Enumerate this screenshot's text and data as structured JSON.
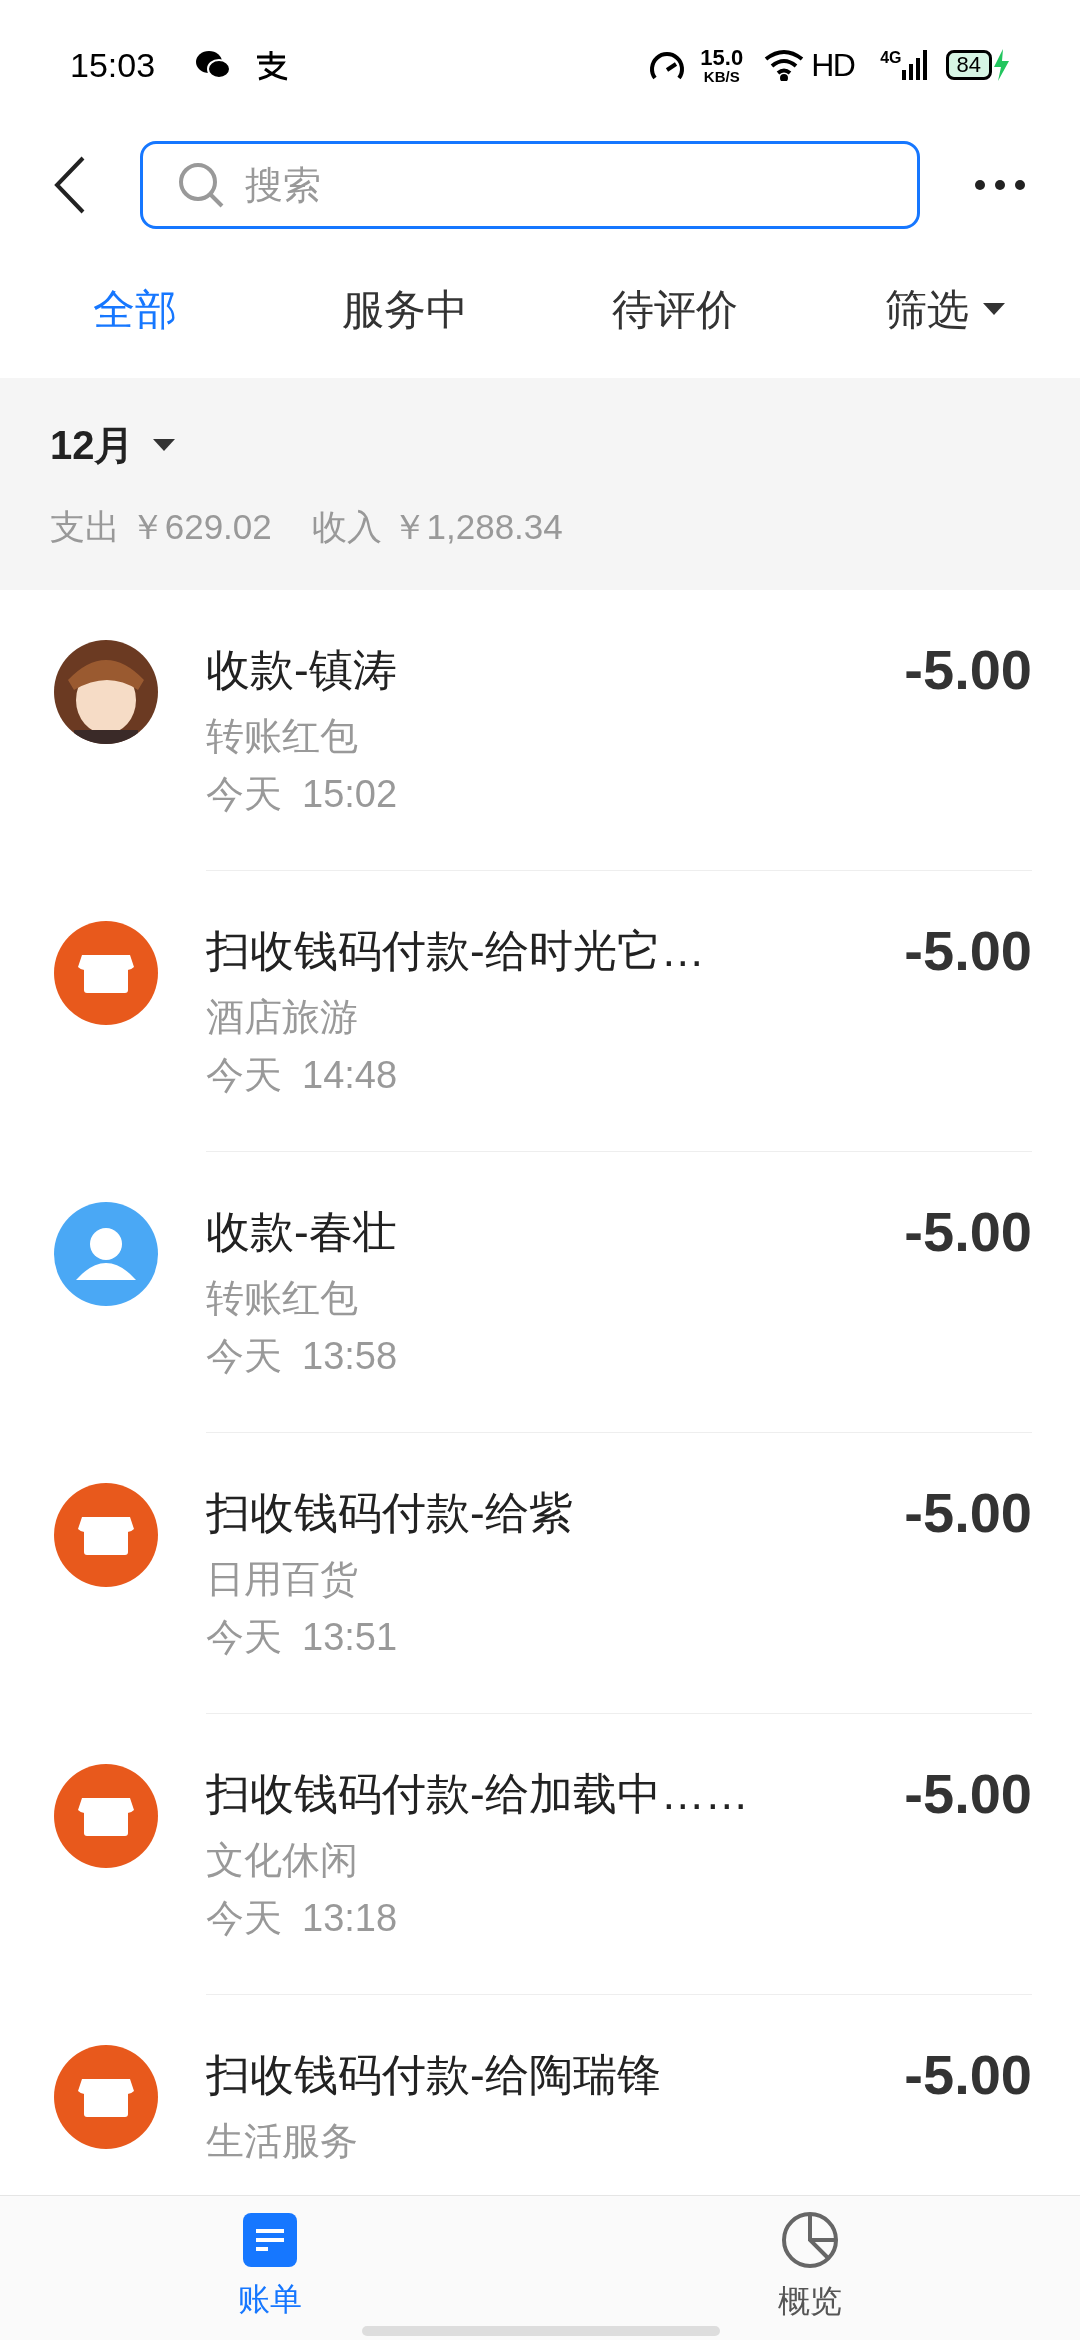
{
  "status_bar": {
    "time": "15:03",
    "speed": "15.0",
    "speed_unit": "KB/S",
    "hd": "HD",
    "network": "4G",
    "battery": "84"
  },
  "search": {
    "placeholder": "搜索"
  },
  "tabs": [
    {
      "label": "全部",
      "selected": true
    },
    {
      "label": "服务中",
      "selected": false
    },
    {
      "label": "待评价",
      "selected": false
    },
    {
      "label": "筛选",
      "selected": false,
      "kind": "dropdown"
    }
  ],
  "summary": {
    "month": "12月",
    "expense": "支出 ￥629.02",
    "income": "收入 ￥1,288.34"
  },
  "transactions": [
    {
      "kind": "avatar",
      "title": "收款-镇涛",
      "category": "转账红包",
      "date": "今天",
      "time": "15:02",
      "amount": "-5.00"
    },
    {
      "kind": "store",
      "title": "扫收钱码付款-给时光它…",
      "category": "酒店旅游",
      "date": "今天",
      "time": "14:48",
      "amount": "-5.00"
    },
    {
      "kind": "person",
      "title": "收款-春壮",
      "category": "转账红包",
      "date": "今天",
      "time": "13:58",
      "amount": "-5.00"
    },
    {
      "kind": "store",
      "title": "扫收钱码付款-给紫",
      "category": "日用百货",
      "date": "今天",
      "time": "13:51",
      "amount": "-5.00"
    },
    {
      "kind": "store",
      "title": "扫收钱码付款-给加载中……",
      "category": "文化休闲",
      "date": "今天",
      "time": "13:18",
      "amount": "-5.00"
    },
    {
      "kind": "store",
      "title": "扫收钱码付款-给陶瑞锋",
      "category": "生活服务",
      "amount": "-5.00"
    }
  ],
  "bottom_nav": [
    {
      "label": "账单",
      "selected": true,
      "kind": "bill"
    },
    {
      "label": "概览",
      "selected": false,
      "kind": "chart"
    }
  ]
}
